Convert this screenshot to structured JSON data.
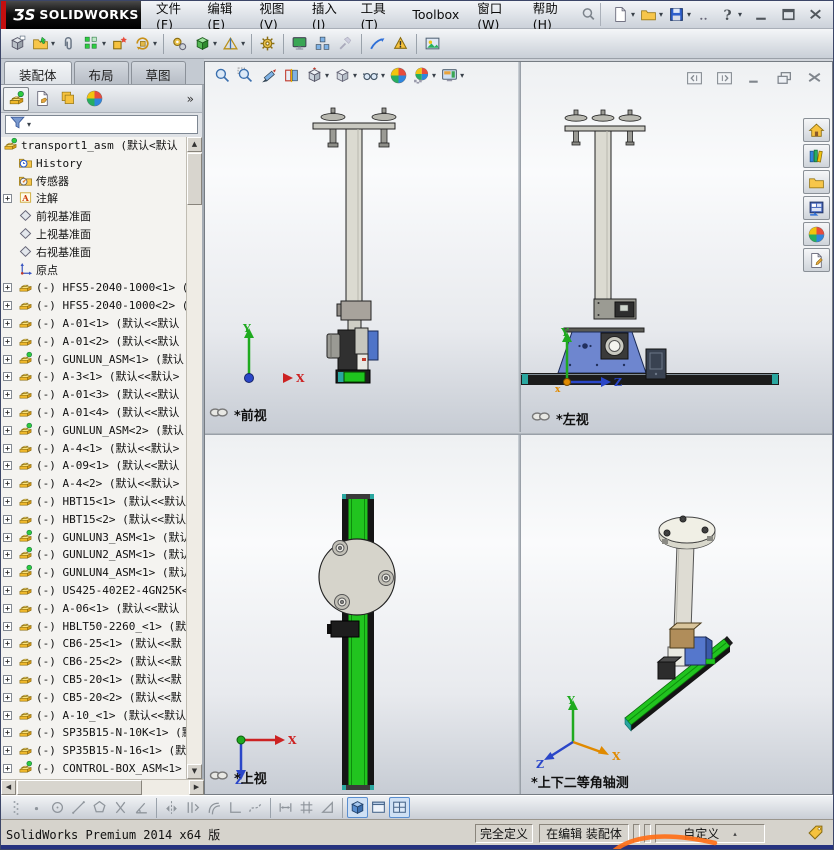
{
  "titlebar": {
    "logo_mark": "ƷS",
    "logo": "SOLIDWORKS",
    "menus": [
      "文件(F)",
      "编辑(E)",
      "视图(V)",
      "插入(I)",
      "工具(T)",
      "Toolbox",
      "窗口(W)",
      "帮助(H)"
    ],
    "quick_icons": [
      "new-doc*",
      "open*",
      "save*",
      "more",
      "help*"
    ],
    "window_controls": [
      "minimize",
      "maximize",
      "close"
    ]
  },
  "toolbar": {
    "icons": [
      "insert-component",
      "open-part*",
      "mate",
      "linear-pattern*",
      "smart-fastener",
      "rotate-component*",
      "|",
      "motion-manager",
      "assembly-features*",
      "reference-geometry*",
      "|",
      "interference-check",
      "|",
      "appearance-screen",
      "exploded-view",
      "tool-disabled",
      "|",
      "instant3d",
      "rebuild-warning",
      "|",
      "scene-image"
    ]
  },
  "command_tabs": [
    {
      "label": "装配体",
      "active": true
    },
    {
      "label": "布局",
      "active": false
    },
    {
      "label": "草图",
      "active": false
    }
  ],
  "fm": {
    "tabs": [
      "feature-tree",
      "property-manager",
      "configuration-manager",
      "appearance-manager"
    ],
    "overflow_chevron": "»"
  },
  "feature_tree": {
    "items": [
      {
        "icon": "asm-root",
        "label": "transport1_asm (默认<默认",
        "exp": false,
        "root": true
      },
      {
        "icon": "folder-clock",
        "label": "History",
        "exp": false
      },
      {
        "icon": "folder-sensor",
        "label": "传感器",
        "exp": false
      },
      {
        "icon": "annotations",
        "label": "注解",
        "exp": true
      },
      {
        "icon": "plane",
        "label": "前视基准面",
        "exp": false
      },
      {
        "icon": "plane",
        "label": "上视基准面",
        "exp": false
      },
      {
        "icon": "plane",
        "label": "右视基准面",
        "exp": false
      },
      {
        "icon": "origin",
        "label": "原点",
        "exp": false
      },
      {
        "icon": "part",
        "label": "(-) HFS5-2040-1000<1> (",
        "exp": true
      },
      {
        "icon": "part",
        "label": "(-) HFS5-2040-1000<2> (",
        "exp": true
      },
      {
        "icon": "part",
        "label": "(-) A-01<1> (默认<<默认",
        "exp": true
      },
      {
        "icon": "part",
        "label": "(-) A-01<2> (默认<<默认",
        "exp": true
      },
      {
        "icon": "subasm",
        "label": "(-) GUNLUN_ASM<1> (默认",
        "exp": true
      },
      {
        "icon": "part",
        "label": "(-) A-3<1> (默认<<默认>",
        "exp": true
      },
      {
        "icon": "part",
        "label": "(-) A-01<3> (默认<<默认",
        "exp": true
      },
      {
        "icon": "part",
        "label": "(-) A-01<4> (默认<<默认",
        "exp": true
      },
      {
        "icon": "subasm",
        "label": "(-) GUNLUN_ASM<2> (默认",
        "exp": true
      },
      {
        "icon": "part",
        "label": "(-) A-4<1> (默认<<默认>",
        "exp": true
      },
      {
        "icon": "part",
        "label": "(-) A-09<1> (默认<<默认",
        "exp": true
      },
      {
        "icon": "part",
        "label": "(-) A-4<2> (默认<<默认>",
        "exp": true
      },
      {
        "icon": "part",
        "label": "(-) HBT15<1> (默认<<默认",
        "exp": true
      },
      {
        "icon": "part",
        "label": "(-) HBT15<2> (默认<<默认",
        "exp": true
      },
      {
        "icon": "subasm",
        "label": "(-) GUNLUN3_ASM<1> (默认",
        "exp": true
      },
      {
        "icon": "subasm",
        "label": "(-) GUNLUN2_ASM<1> (默认",
        "exp": true
      },
      {
        "icon": "subasm",
        "label": "(-) GUNLUN4_ASM<1> (默认",
        "exp": true
      },
      {
        "icon": "part",
        "label": "(-) US425-402E2-4GN25K<",
        "exp": true
      },
      {
        "icon": "part",
        "label": "(-) A-06<1> (默认<<默认",
        "exp": true
      },
      {
        "icon": "part",
        "label": "(-) HBLT50-2260_<1> (默",
        "exp": true
      },
      {
        "icon": "part",
        "label": "(-) CB6-25<1> (默认<<默",
        "exp": true
      },
      {
        "icon": "part",
        "label": "(-) CB6-25<2> (默认<<默",
        "exp": true
      },
      {
        "icon": "part",
        "label": "(-) CB5-20<1> (默认<<默",
        "exp": true
      },
      {
        "icon": "part",
        "label": "(-) CB5-20<2> (默认<<默",
        "exp": true
      },
      {
        "icon": "part",
        "label": "(-) A-10_<1> (默认<<默认",
        "exp": true
      },
      {
        "icon": "part",
        "label": "(-) SP35B15-N-10K<1> (默",
        "exp": true
      },
      {
        "icon": "part",
        "label": "(-) SP35B15-N-16<1> (默",
        "exp": true
      },
      {
        "icon": "subasm",
        "label": "(-) CONTROL-BOX_ASM<1>",
        "exp": true
      }
    ]
  },
  "headsup": {
    "icons": [
      "zoom-fit",
      "zoom-area",
      "previous-view",
      "section-view",
      "view-orientation*",
      "display-style*",
      "hide-show*",
      "edit-appearance",
      "apply-scene*",
      "view-settings*"
    ]
  },
  "doc_controls": [
    "pane-left",
    "pane-right",
    "win-min",
    "win-restore",
    "win-close"
  ],
  "viewports": [
    {
      "label": "*前视",
      "linked": true
    },
    {
      "label": "*左视",
      "linked": true
    },
    {
      "label": "*上视",
      "linked": true
    },
    {
      "label": "*上下二等角轴测",
      "linked": false
    }
  ],
  "taskpane": [
    "home",
    "design-library",
    "file-explorer",
    "view-palette",
    "appearances",
    "custom-properties"
  ],
  "bottom_toolbar": [
    "grip",
    "point",
    "circle",
    "line",
    "polygon",
    "trim",
    "angle",
    "|",
    "mirror",
    "convert-entities",
    "offset",
    "corner",
    "spline",
    "|",
    "smart-dimension",
    "grid",
    "make-block",
    "|",
    "display-cube#",
    "single-view",
    "four-view#"
  ],
  "statusbar": {
    "product": "SolidWorks Premium 2014 x64 版",
    "define_state": "完全定义",
    "edit_state": "在编辑 装配体",
    "custom": "自定义",
    "tag_icon": "tag"
  }
}
